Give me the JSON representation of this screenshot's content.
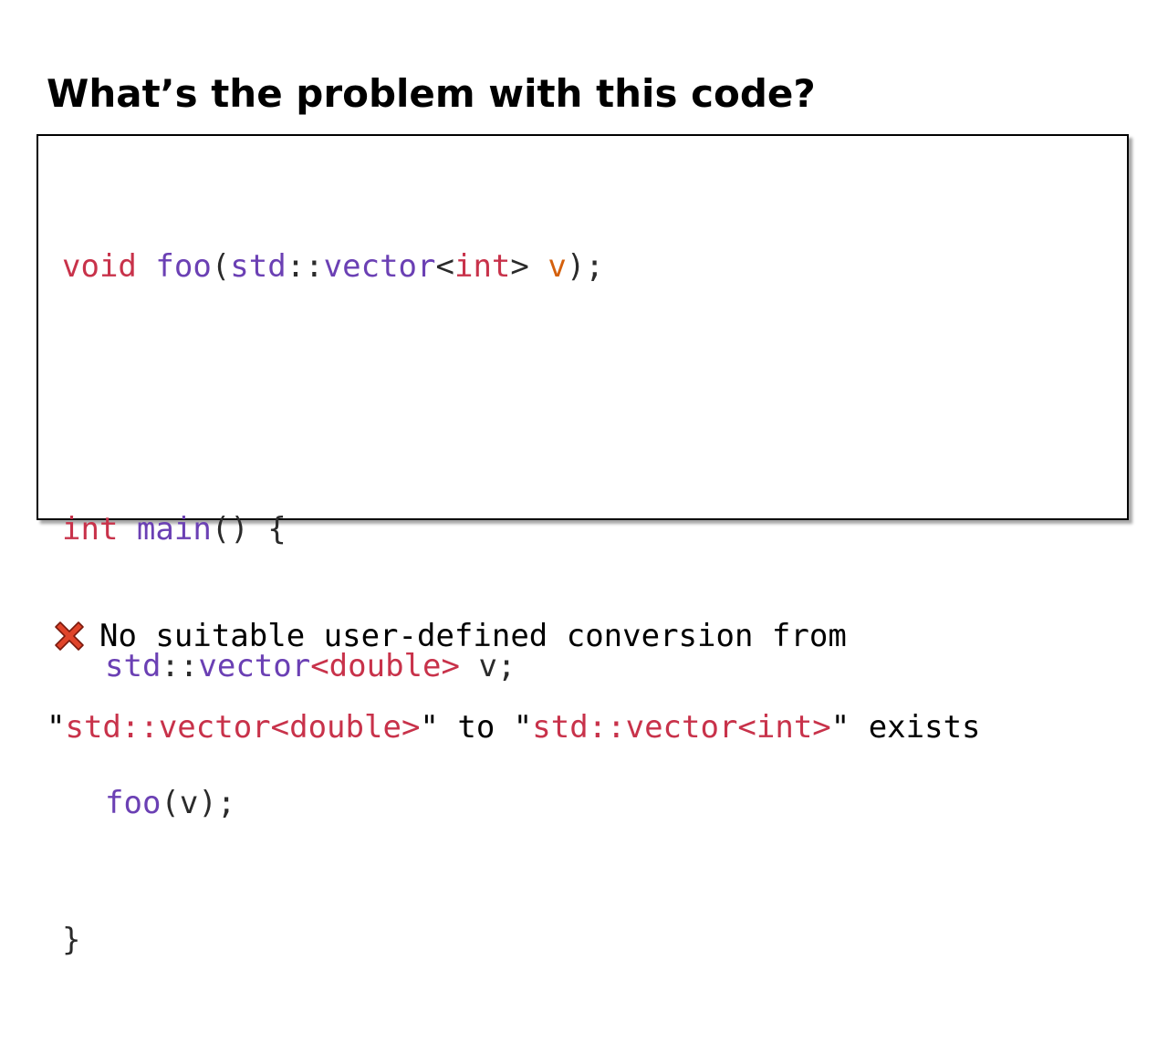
{
  "slide": {
    "title": "What’s the problem with this code?"
  },
  "code": {
    "line1": {
      "kw_void": "void",
      "fn_foo": "foo",
      "open_paren": "(",
      "std": "std",
      "scope": "::",
      "vector": "vector",
      "lt": "<",
      "kw_int": "int",
      "gt": ">",
      "space": " ",
      "param_v": "v",
      "close": ");"
    },
    "line3": {
      "kw_int": "int",
      "fn_main": "main",
      "rest": "() {"
    },
    "line4": {
      "std": "std",
      "scope": "::",
      "vector": "vector",
      "template": "<double>",
      "rest": " v;"
    },
    "line5": {
      "fn_foo": "foo",
      "rest": "(v);"
    },
    "line6": {
      "brace": "}"
    }
  },
  "message": {
    "icon": "x-mark-icon",
    "line1_text": "No suitable user-defined conversion from",
    "quote_open_1": "\"",
    "type_from": "std::vector<double>",
    "middle": "\" to \"",
    "type_to": "std::vector<int>",
    "tail": "\" exists"
  },
  "colors": {
    "keyword": "#c8324a",
    "function": "#6b40b4",
    "parameter": "#d4600c",
    "text": "#2b2b2b",
    "icon_fill": "#e0442a"
  }
}
